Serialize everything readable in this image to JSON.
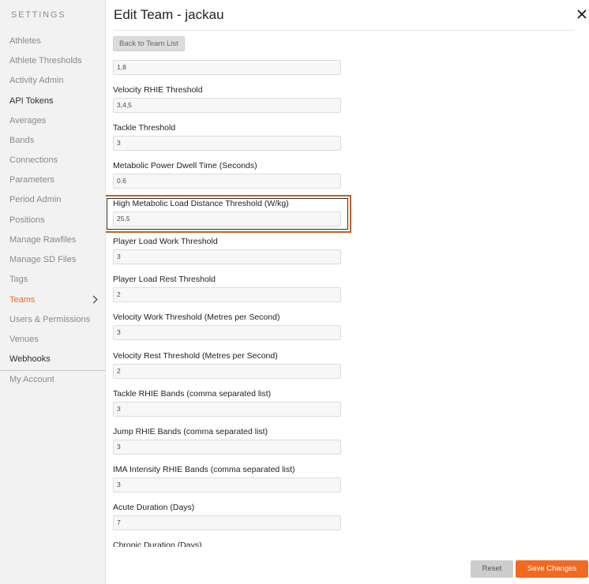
{
  "sidebar": {
    "heading": "SETTINGS",
    "items": [
      {
        "label": "Athletes"
      },
      {
        "label": "Athlete Thresholds"
      },
      {
        "label": "Activity Admin"
      },
      {
        "label": "API Tokens"
      },
      {
        "label": "Averages"
      },
      {
        "label": "Bands"
      },
      {
        "label": "Connections"
      },
      {
        "label": "Parameters"
      },
      {
        "label": "Period Admin"
      },
      {
        "label": "Positions"
      },
      {
        "label": "Manage Rawfiles"
      },
      {
        "label": "Manage SD Files"
      },
      {
        "label": "Tags"
      },
      {
        "label": "Teams"
      },
      {
        "label": "Users & Permissions"
      },
      {
        "label": "Venues"
      },
      {
        "label": "Webhooks"
      }
    ],
    "account": "My Account",
    "active_color": "#f26a21"
  },
  "header": {
    "title": "Edit Team - jackau",
    "close_icon": "close-icon",
    "back_label": "Back to Team List"
  },
  "form": {
    "fields": [
      {
        "label": "",
        "value": "1,8"
      },
      {
        "label": "Velocity RHIE Threshold",
        "value": "3,4,5"
      },
      {
        "label": "Tackle Threshold",
        "value": "3"
      },
      {
        "label": "Metabolic Power Dwell Time (Seconds)",
        "value": "0.6"
      },
      {
        "label": "High Metabolic Load Distance Threshold (W/kg)",
        "value": "25.5"
      },
      {
        "label": "Player Load Work Threshold",
        "value": "3"
      },
      {
        "label": "Player Load Rest Threshold",
        "value": "2"
      },
      {
        "label": "Velocity Work Threshold (Metres per Second)",
        "value": "3"
      },
      {
        "label": "Velocity Rest Threshold (Metres per Second)",
        "value": "2"
      },
      {
        "label": "Tackle RHIE Bands (comma separated list)",
        "value": "3"
      },
      {
        "label": "Jump RHIE Bands (comma separated list)",
        "value": "3"
      },
      {
        "label": "IMA Intensity RHIE Bands (comma separated list)",
        "value": "3"
      },
      {
        "label": "Acute Duration (Days)",
        "value": "7"
      },
      {
        "label": "Chronic Duration (Days)",
        "value": ""
      }
    ]
  },
  "footer": {
    "reset_label": "Reset",
    "save_label": "Save Changes",
    "accent": "#f26a21"
  }
}
